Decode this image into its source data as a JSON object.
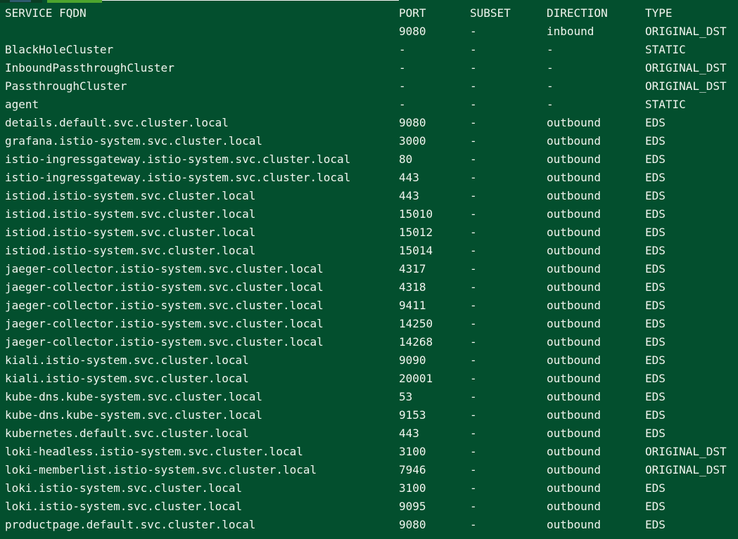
{
  "headers": {
    "service": "SERVICE FQDN",
    "port": "PORT",
    "subset": "SUBSET",
    "direction": "DIRECTION",
    "type": "TYPE"
  },
  "rows": [
    {
      "service": "",
      "port": "9080",
      "subset": "-",
      "direction": "inbound",
      "type": "ORIGINAL_DST"
    },
    {
      "service": "BlackHoleCluster",
      "port": "-",
      "subset": "-",
      "direction": "-",
      "type": "STATIC"
    },
    {
      "service": "InboundPassthroughCluster",
      "port": "-",
      "subset": "-",
      "direction": "-",
      "type": "ORIGINAL_DST"
    },
    {
      "service": "PassthroughCluster",
      "port": "-",
      "subset": "-",
      "direction": "-",
      "type": "ORIGINAL_DST"
    },
    {
      "service": "agent",
      "port": "-",
      "subset": "-",
      "direction": "-",
      "type": "STATIC"
    },
    {
      "service": "details.default.svc.cluster.local",
      "port": "9080",
      "subset": "-",
      "direction": "outbound",
      "type": "EDS"
    },
    {
      "service": "grafana.istio-system.svc.cluster.local",
      "port": "3000",
      "subset": "-",
      "direction": "outbound",
      "type": "EDS"
    },
    {
      "service": "istio-ingressgateway.istio-system.svc.cluster.local",
      "port": "80",
      "subset": "-",
      "direction": "outbound",
      "type": "EDS"
    },
    {
      "service": "istio-ingressgateway.istio-system.svc.cluster.local",
      "port": "443",
      "subset": "-",
      "direction": "outbound",
      "type": "EDS"
    },
    {
      "service": "istiod.istio-system.svc.cluster.local",
      "port": "443",
      "subset": "-",
      "direction": "outbound",
      "type": "EDS"
    },
    {
      "service": "istiod.istio-system.svc.cluster.local",
      "port": "15010",
      "subset": "-",
      "direction": "outbound",
      "type": "EDS"
    },
    {
      "service": "istiod.istio-system.svc.cluster.local",
      "port": "15012",
      "subset": "-",
      "direction": "outbound",
      "type": "EDS"
    },
    {
      "service": "istiod.istio-system.svc.cluster.local",
      "port": "15014",
      "subset": "-",
      "direction": "outbound",
      "type": "EDS"
    },
    {
      "service": "jaeger-collector.istio-system.svc.cluster.local",
      "port": "4317",
      "subset": "-",
      "direction": "outbound",
      "type": "EDS"
    },
    {
      "service": "jaeger-collector.istio-system.svc.cluster.local",
      "port": "4318",
      "subset": "-",
      "direction": "outbound",
      "type": "EDS"
    },
    {
      "service": "jaeger-collector.istio-system.svc.cluster.local",
      "port": "9411",
      "subset": "-",
      "direction": "outbound",
      "type": "EDS"
    },
    {
      "service": "jaeger-collector.istio-system.svc.cluster.local",
      "port": "14250",
      "subset": "-",
      "direction": "outbound",
      "type": "EDS"
    },
    {
      "service": "jaeger-collector.istio-system.svc.cluster.local",
      "port": "14268",
      "subset": "-",
      "direction": "outbound",
      "type": "EDS"
    },
    {
      "service": "kiali.istio-system.svc.cluster.local",
      "port": "9090",
      "subset": "-",
      "direction": "outbound",
      "type": "EDS"
    },
    {
      "service": "kiali.istio-system.svc.cluster.local",
      "port": "20001",
      "subset": "-",
      "direction": "outbound",
      "type": "EDS"
    },
    {
      "service": "kube-dns.kube-system.svc.cluster.local",
      "port": "53",
      "subset": "-",
      "direction": "outbound",
      "type": "EDS"
    },
    {
      "service": "kube-dns.kube-system.svc.cluster.local",
      "port": "9153",
      "subset": "-",
      "direction": "outbound",
      "type": "EDS"
    },
    {
      "service": "kubernetes.default.svc.cluster.local",
      "port": "443",
      "subset": "-",
      "direction": "outbound",
      "type": "EDS"
    },
    {
      "service": "loki-headless.istio-system.svc.cluster.local",
      "port": "3100",
      "subset": "-",
      "direction": "outbound",
      "type": "ORIGINAL_DST"
    },
    {
      "service": "loki-memberlist.istio-system.svc.cluster.local",
      "port": "7946",
      "subset": "-",
      "direction": "outbound",
      "type": "ORIGINAL_DST"
    },
    {
      "service": "loki.istio-system.svc.cluster.local",
      "port": "3100",
      "subset": "-",
      "direction": "outbound",
      "type": "EDS"
    },
    {
      "service": "loki.istio-system.svc.cluster.local",
      "port": "9095",
      "subset": "-",
      "direction": "outbound",
      "type": "EDS"
    },
    {
      "service": "productpage.default.svc.cluster.local",
      "port": "9080",
      "subset": "-",
      "direction": "outbound",
      "type": "EDS"
    }
  ],
  "colors": {
    "background": "#034f2e",
    "text": "#f1f5ef",
    "prompt_green": "#4ea52e"
  }
}
